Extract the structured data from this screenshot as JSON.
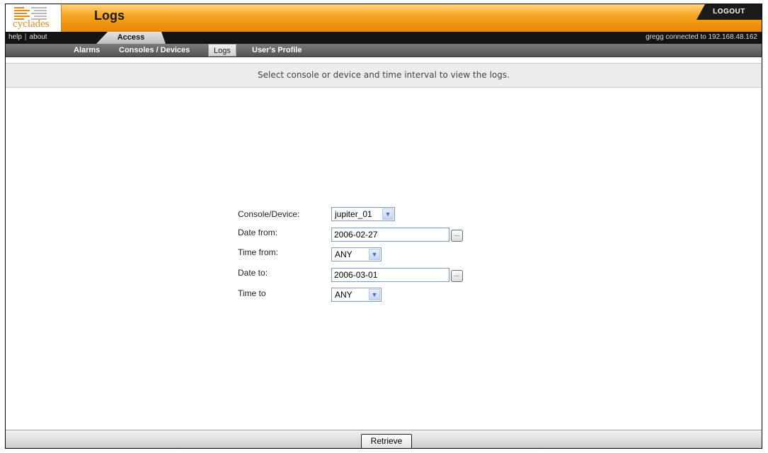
{
  "header": {
    "logo_text": "cyclades",
    "title": "Logs",
    "logout_label": "LOGOUT"
  },
  "topnav": {
    "help_label": "help",
    "separator": "|",
    "about_label": "about",
    "active_tab": "Access",
    "connection_info": "gregg connected to 192.168.48.162"
  },
  "subnav": {
    "items": [
      {
        "label": "Alarms"
      },
      {
        "label": "Consoles / Devices"
      },
      {
        "label": "Logs",
        "active": true
      },
      {
        "label": "User's Profile"
      }
    ]
  },
  "instruction": "Select console or device and time interval to view the logs.",
  "form": {
    "console_label": "Console/Device:",
    "console_value": "jupiter_01",
    "date_from_label": "Date from:",
    "date_from_value": "2006-02-27",
    "time_from_label": "Time from:",
    "time_from_value": "ANY",
    "date_to_label": "Date to:",
    "date_to_value": "2006-03-01",
    "time_to_label": "Time to",
    "time_to_value": "ANY",
    "calendar_button_label": "..."
  },
  "footer": {
    "retrieve_label": "Retrieve"
  },
  "colors": {
    "header_orange": "#f6a623",
    "nav_black": "#141414",
    "subnav_gray": "#5e5e5e",
    "instruction_bg": "#ececec"
  }
}
